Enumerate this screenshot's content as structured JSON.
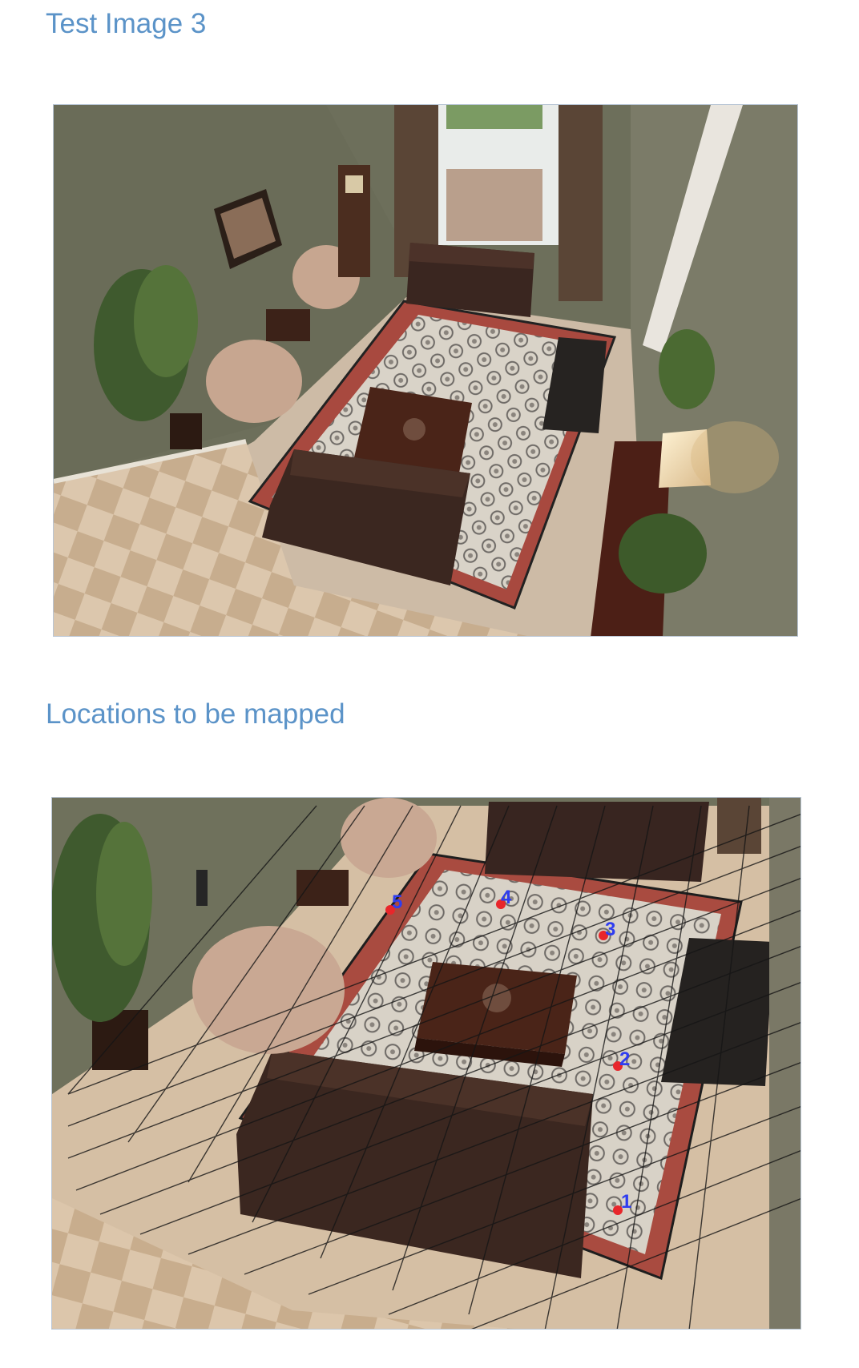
{
  "headings": {
    "test_image": "Test Image 3",
    "locations": "Locations to be mapped"
  },
  "figures": {
    "top": {
      "description": "living room viewed from above"
    },
    "bottom": {
      "description": "living room with floor grid overlay",
      "markers": [
        "1",
        "2",
        "3",
        "4",
        "5"
      ]
    }
  },
  "colors": {
    "heading": "#5b93c8",
    "marker_dot": "#e8262b",
    "marker_label": "#2f3df0",
    "wall": "#6d6f5b",
    "tile": "#d8c3aa",
    "carpet": "#c9b9a6",
    "rug_border": "#a8493f",
    "sofa": "#3b2720"
  }
}
